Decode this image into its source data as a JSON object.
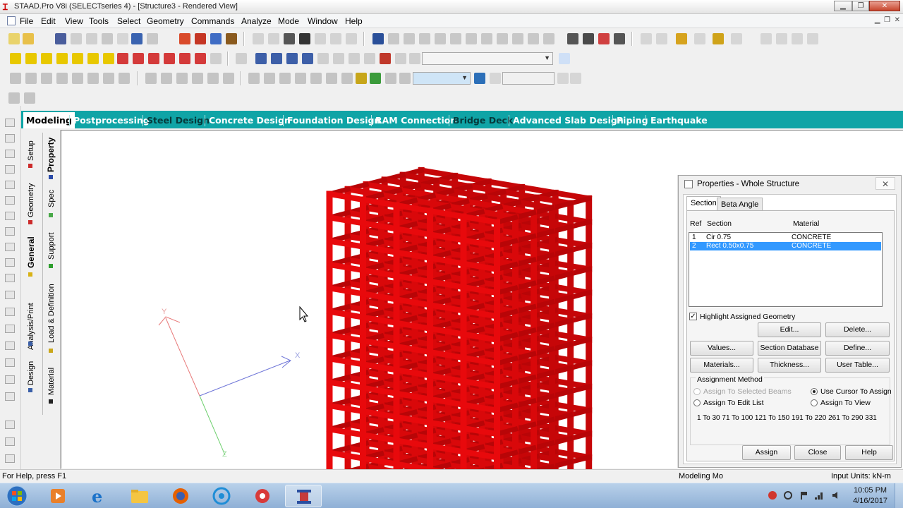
{
  "window": {
    "title": "STAAD.Pro V8i (SELECTseries 4) - [Structure3 - Rendered View]"
  },
  "menu": [
    "File",
    "Edit",
    "View",
    "Tools",
    "Select",
    "Geometry",
    "Commands",
    "Analyze",
    "Mode",
    "Window",
    "Help"
  ],
  "page_tabs": [
    {
      "label": "Modeling",
      "active": true
    },
    {
      "label": "Postprocessing"
    },
    {
      "label": "Steel Design"
    },
    {
      "label": "Concrete Design"
    },
    {
      "label": "Foundation Design"
    },
    {
      "label": "RAM Connection"
    },
    {
      "label": "Bridge Deck"
    },
    {
      "label": "Advanced Slab Design"
    },
    {
      "label": "Piping"
    },
    {
      "label": "Earthquake"
    }
  ],
  "side_tabs": {
    "outer": [
      "Setup",
      "Geometry",
      "General",
      "Analysis/Print",
      "Design"
    ],
    "inner": [
      "Property",
      "Spec",
      "Support",
      "Load & Definition",
      "Material"
    ]
  },
  "axes": {
    "x": "X",
    "y": "Y",
    "z": "Z"
  },
  "structure_color": "#e8090c",
  "properties": {
    "title": "Properties - Whole Structure",
    "close_glyph": "✕",
    "tabs": [
      "Section",
      "Beta Angle"
    ],
    "headers": {
      "ref": "Ref",
      "section": "Section",
      "material": "Material"
    },
    "rows": [
      {
        "ref": "1",
        "section": "Cir 0.75",
        "material": "CONCRETE",
        "selected": false
      },
      {
        "ref": "2",
        "section": "Rect 0.50x0.75",
        "material": "CONCRETE",
        "selected": true
      }
    ],
    "highlight_label": "Highlight Assigned Geometry",
    "highlight_checked": "✓",
    "buttons": {
      "edit": "Edit...",
      "delete": "Delete...",
      "values": "Values...",
      "section_database": "Section Database",
      "define": "Define...",
      "materials": "Materials...",
      "thickness": "Thickness...",
      "user_table": "User Table...",
      "assign": "Assign",
      "close": "Close",
      "help": "Help"
    },
    "assignment_method": {
      "title": "Assignment Method",
      "options": [
        {
          "label": "Assign To Selected Beams",
          "selected": false,
          "disabled": true
        },
        {
          "label": "Use Cursor To Assign",
          "selected": true,
          "disabled": false
        },
        {
          "label": "Assign To Edit List",
          "selected": false,
          "disabled": false
        },
        {
          "label": "Assign To View",
          "selected": false,
          "disabled": false
        }
      ],
      "edit_list": "1 To 30 71 To 100 121 To 150 191 To 220 261 To 290 331"
    }
  },
  "status": {
    "help": "For Help, press F1",
    "mode": "Modeling Mo",
    "units": "Input Units:  kN-m"
  },
  "taskbar": {
    "time": "10:05 PM",
    "date": "4/16/2017"
  }
}
